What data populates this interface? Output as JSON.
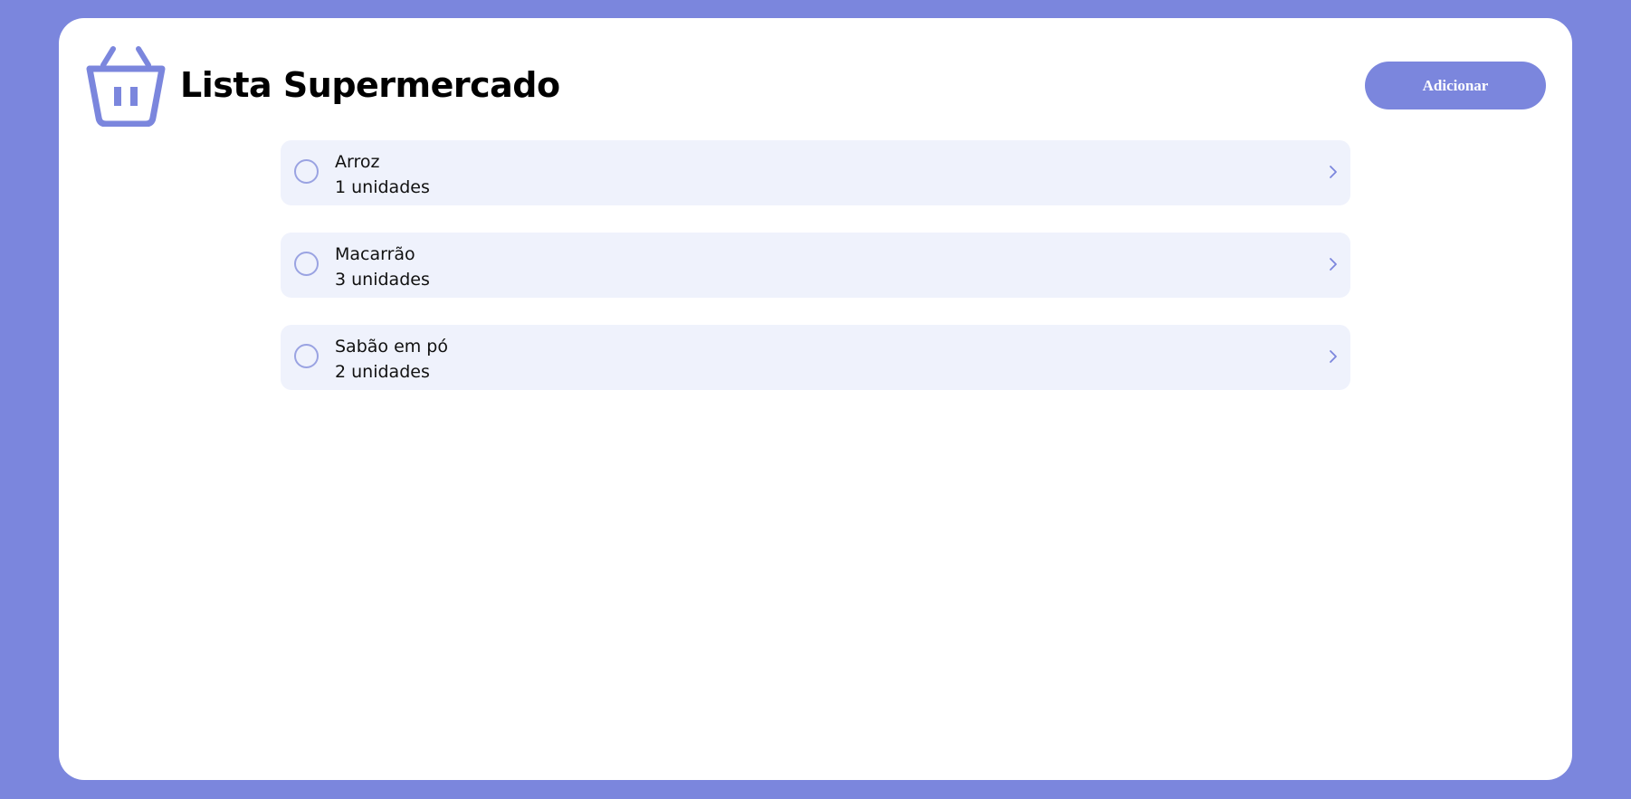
{
  "header": {
    "title": "Lista Supermercado",
    "icon": "shopping-basket-icon",
    "add_label": "Adicionar"
  },
  "items": [
    {
      "name": "Arroz",
      "quantity": "1 unidades"
    },
    {
      "name": "Macarrão",
      "quantity": "3 unidades"
    },
    {
      "name": "Sabão em pó",
      "quantity": "2 unidades"
    }
  ],
  "colors": {
    "accent": "#7b86dd",
    "item_background": "#eff2fc",
    "card_background": "#ffffff"
  }
}
